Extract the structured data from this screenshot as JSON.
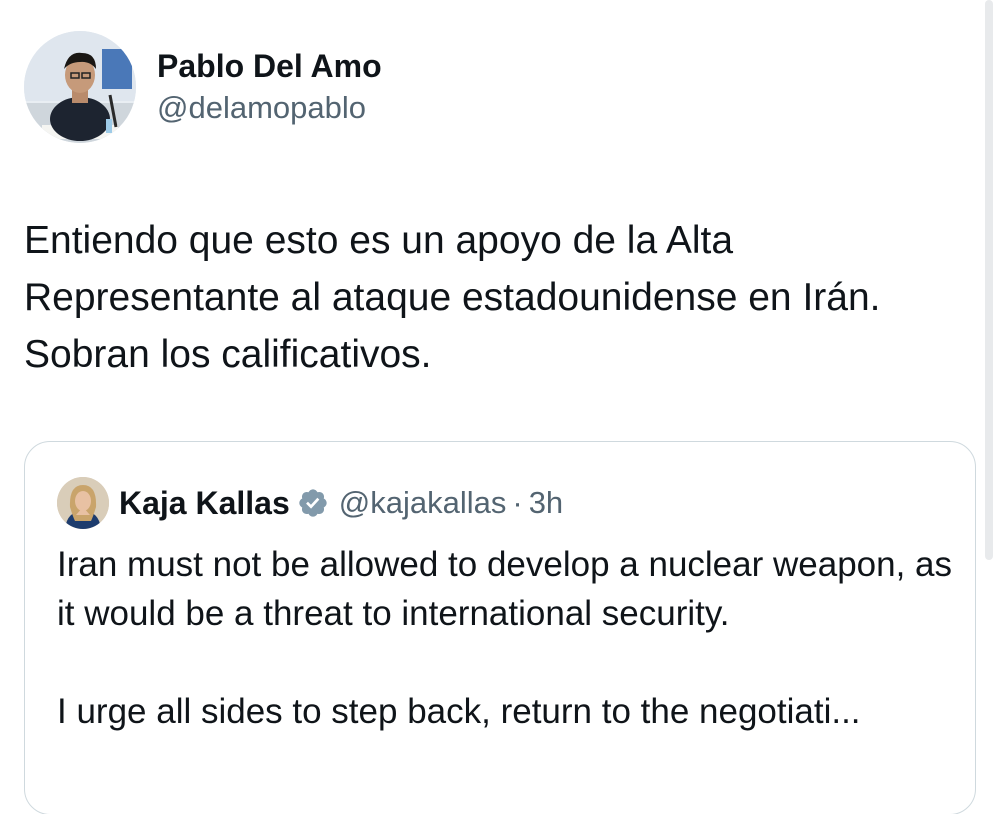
{
  "tweet": {
    "author": {
      "display_name": "Pablo Del Amo",
      "handle": "@delamopablo"
    },
    "text": "Entiendo que esto es un apoyo de la Alta\nRepresentante al ataque estadounidense en Irán.\nSobran los calificativos."
  },
  "quoted_tweet": {
    "author": {
      "display_name": "Kaja Kallas",
      "handle": "@kajakallas",
      "verified": true
    },
    "separator": "·",
    "time": "3h",
    "paragraph_1": "Iran must not be allowed to develop a nuclear weapon, as it would be a threat to international security.",
    "paragraph_2": "I urge all sides to step back, return to the negotiati..."
  },
  "colors": {
    "text_primary": "#0f1419",
    "text_secondary": "#536471",
    "card_border": "#cfd9de",
    "verified_badge": "#829aab"
  }
}
